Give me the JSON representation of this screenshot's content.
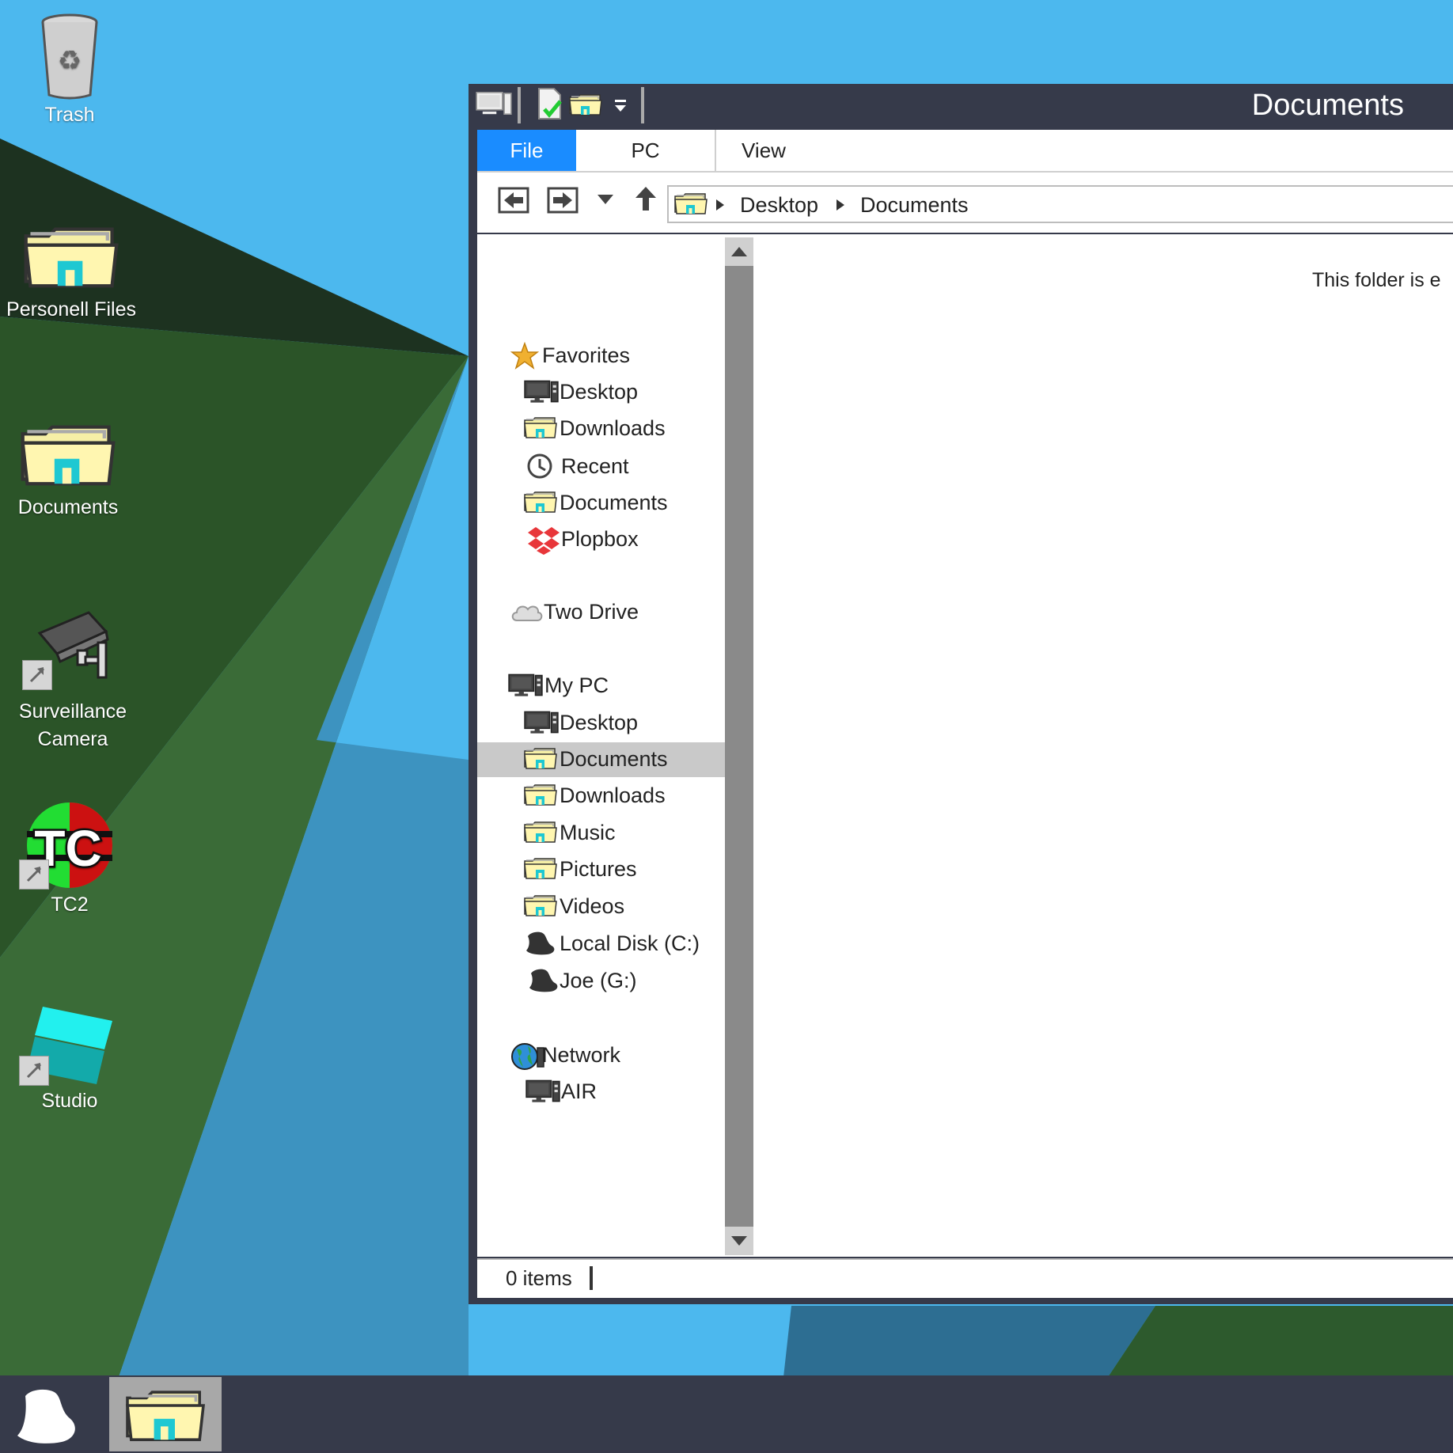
{
  "desktop": {
    "icons": [
      {
        "label": "Trash",
        "icon": "trash-icon"
      },
      {
        "label": "Personell Files",
        "icon": "folder-icon"
      },
      {
        "label": "Documents",
        "icon": "folder-icon"
      },
      {
        "label": "Surveillance Camera",
        "icon": "camera-icon",
        "shortcut": true
      },
      {
        "label": "TC2",
        "icon": "tc2-logo-icon",
        "shortcut": true
      },
      {
        "label": "Studio",
        "icon": "studio-icon",
        "shortcut": true
      }
    ]
  },
  "window": {
    "title": "Documents",
    "quick_access": [
      "pc-icon",
      "new-file-icon",
      "new-folder-icon",
      "dropdown-icon"
    ],
    "tabs": [
      {
        "label": "File",
        "active": true
      },
      {
        "label": "PC"
      },
      {
        "label": "View"
      }
    ],
    "nav_buttons": [
      "back-icon",
      "forward-icon",
      "recent-dropdown-icon",
      "up-icon"
    ],
    "breadcrumb": [
      "Desktop",
      "Documents"
    ],
    "sidebar": {
      "favorites": {
        "label": "Favorites",
        "items": [
          {
            "label": "Desktop",
            "icon": "pc-icon"
          },
          {
            "label": "Downloads",
            "icon": "folder-icon"
          },
          {
            "label": "Recent",
            "icon": "clock-icon"
          },
          {
            "label": "Documents",
            "icon": "folder-icon"
          },
          {
            "label": "Plopbox",
            "icon": "plopbox-icon"
          }
        ]
      },
      "two_drive": {
        "label": "Two Drive",
        "icon": "cloud-icon"
      },
      "my_pc": {
        "label": "My PC",
        "items": [
          {
            "label": "Desktop",
            "icon": "pc-icon"
          },
          {
            "label": "Documents",
            "icon": "folder-icon",
            "selected": true
          },
          {
            "label": "Downloads",
            "icon": "folder-icon"
          },
          {
            "label": "Music",
            "icon": "folder-icon"
          },
          {
            "label": "Pictures",
            "icon": "folder-icon"
          },
          {
            "label": "Videos",
            "icon": "folder-icon"
          },
          {
            "label": "Local Disk (C:)",
            "icon": "hat-drive-icon"
          },
          {
            "label": "Joe (G:)",
            "icon": "hat-drive-icon"
          }
        ]
      },
      "network": {
        "label": "Network",
        "items": [
          {
            "label": "AIR",
            "icon": "pc-icon"
          }
        ]
      }
    },
    "content": {
      "empty_message": "This folder is e"
    },
    "status": {
      "items": "0 items"
    }
  },
  "taskbar": {
    "items": [
      {
        "icon": "start-hat-icon"
      },
      {
        "icon": "folder-icon",
        "active": true
      }
    ]
  },
  "colors": {
    "accent": "#1a8cff",
    "titlebar": "#363a4a",
    "sky": "#4cb8ee",
    "selection": "#c9c9c9"
  }
}
